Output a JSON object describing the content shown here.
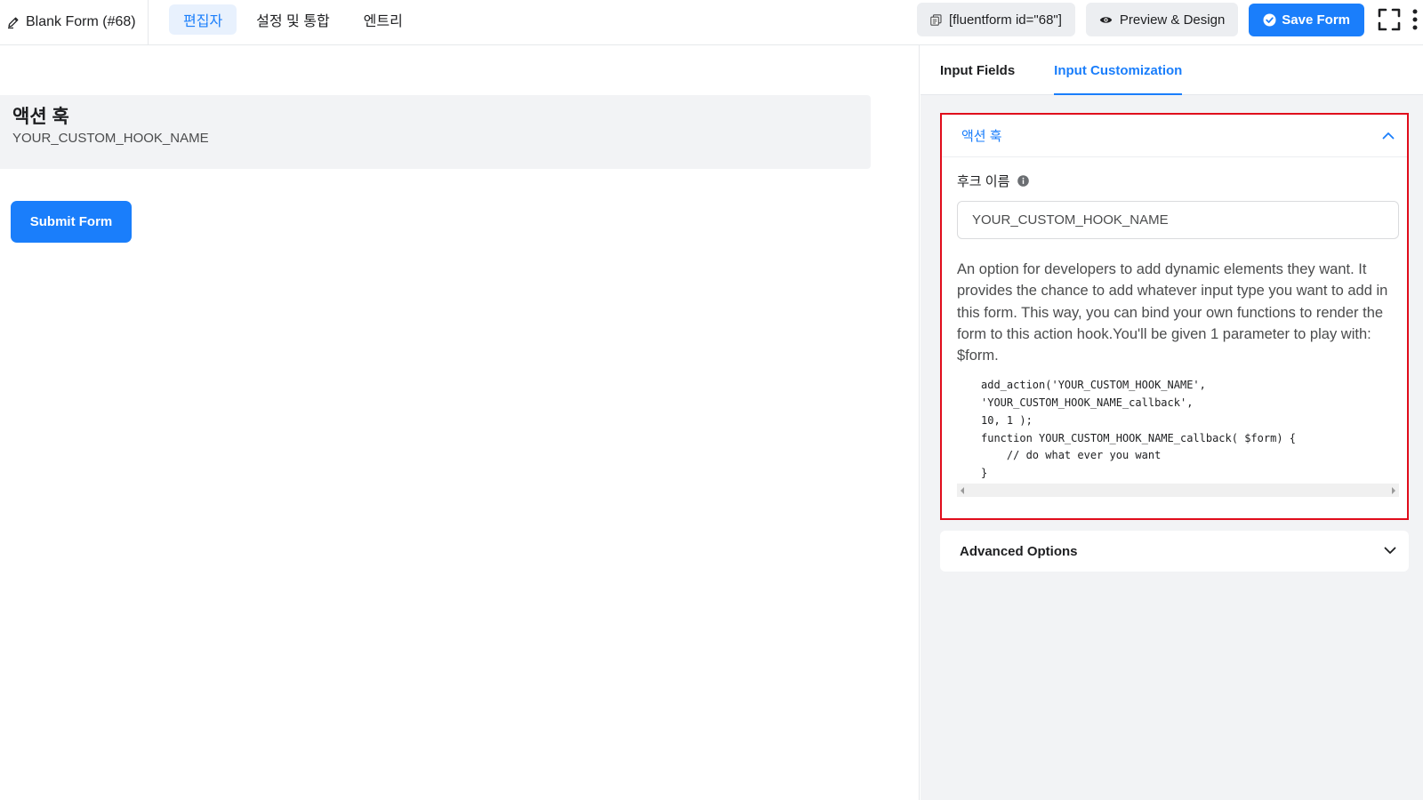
{
  "header": {
    "form_title": "Blank Form (#68)",
    "nav_tabs": [
      {
        "label": "편집자",
        "active": true
      },
      {
        "label": "설정 및 통합",
        "active": false
      },
      {
        "label": "엔트리",
        "active": false
      }
    ],
    "shortcode_label": "[fluentform id=\"68\"]",
    "preview_label": "Preview & Design",
    "save_label": "Save Form"
  },
  "canvas": {
    "hook_title": "액션 훅",
    "hook_value": "YOUR_CUSTOM_HOOK_NAME",
    "submit_label": "Submit Form"
  },
  "panel": {
    "tabs": [
      {
        "label": "Input Fields",
        "active": false
      },
      {
        "label": "Input Customization",
        "active": true
      }
    ],
    "hook_section": {
      "title": "액션 훅",
      "field_label": "후크 이름",
      "input_value": "YOUR_CUSTOM_HOOK_NAME",
      "help_text": "An option for developers to add dynamic elements they want. It provides the chance to add whatever input type you want to add in this form. This way, you can bind your own functions to render the form to this action hook.You'll be given 1 parameter to play with: $form.",
      "code": "add_action('YOUR_CUSTOM_HOOK_NAME',\n'YOUR_CUSTOM_HOOK_NAME_callback',\n10, 1 );\nfunction YOUR_CUSTOM_HOOK_NAME_callback( $form) {\n    // do what ever you want\n}"
    },
    "advanced_title": "Advanced Options"
  },
  "colors": {
    "primary": "#1a7efb",
    "highlight_border": "#e00c1b",
    "panel_bg": "#f2f3f5"
  },
  "icons": [
    "pencil-icon",
    "copy-icon",
    "eye-icon",
    "check-circle-icon",
    "fullscreen-icon",
    "more-vertical-icon",
    "info-icon",
    "chevron-up-icon",
    "chevron-down-icon"
  ]
}
